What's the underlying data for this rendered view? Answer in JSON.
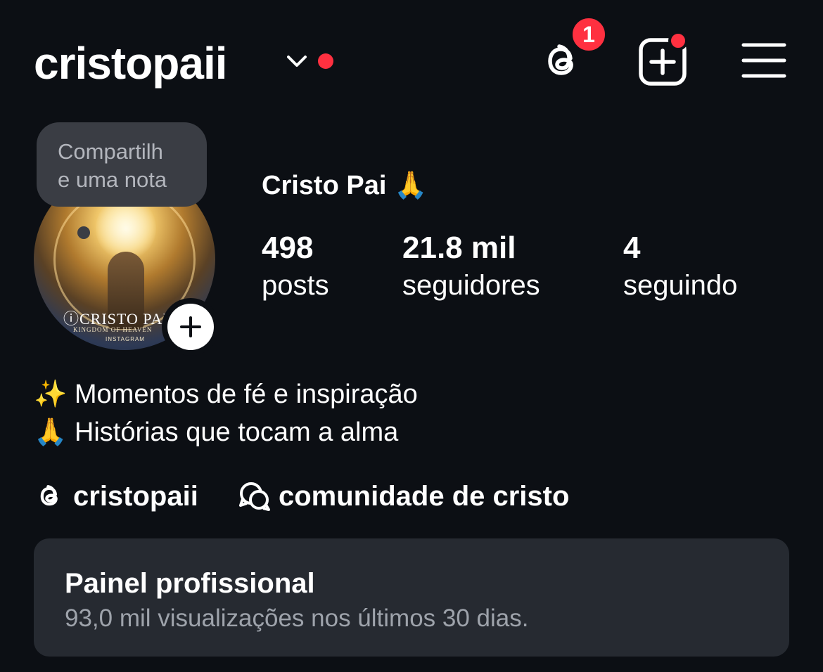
{
  "header": {
    "username": "cristopaii",
    "notification_count": "1"
  },
  "note": {
    "line1": "Compartilh",
    "line2": "e uma nota"
  },
  "avatar": {
    "brand": "ⓘCRISTO PAI",
    "sub1": "KINGDOM OF HEAVEN",
    "sub2": "INSTAGRAM"
  },
  "profile": {
    "display_name": "Cristo Pai 🙏",
    "stats": [
      {
        "value": "498",
        "label": "posts"
      },
      {
        "value": "21.8 mil",
        "label": "seguidores"
      },
      {
        "value": "4",
        "label": "seguindo"
      }
    ]
  },
  "bio": {
    "line1": "✨ Momentos de fé e inspiração",
    "line2": "🙏 Histórias que tocam a alma"
  },
  "links": {
    "threads_handle": "cristopaii",
    "channel_name": "comunidade de cristo"
  },
  "professional": {
    "title": "Painel profissional",
    "subtitle": "93,0 mil visualizações nos últimos 30 dias."
  },
  "colors": {
    "background": "#0c0f14",
    "accent_red": "#ff3040",
    "card": "#262a31",
    "note_bubble": "#3a3d44"
  },
  "icons": {
    "threads": "threads-icon",
    "create": "create-post-icon",
    "menu": "hamburger-menu-icon",
    "chevron": "chevron-down-icon",
    "add_story": "plus-icon",
    "channel": "broadcast-channel-icon"
  }
}
